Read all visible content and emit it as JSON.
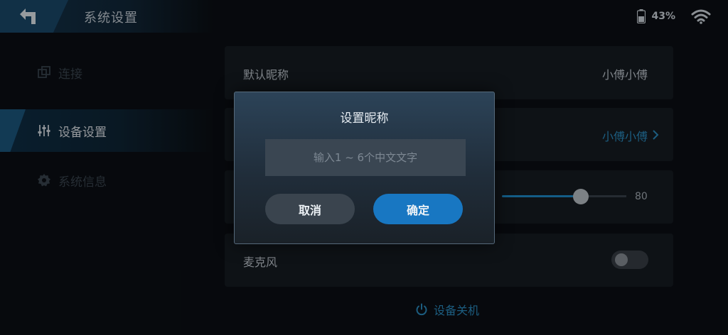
{
  "header": {
    "title": "系统设置",
    "battery": "43%"
  },
  "sidebar": {
    "items": [
      {
        "label": "连接",
        "icon": "link-icon"
      },
      {
        "label": "设备设置",
        "icon": "sliders-icon",
        "active": true
      },
      {
        "label": "系统信息",
        "icon": "gear-icon"
      }
    ]
  },
  "settings": {
    "nickname_label": "默认昵称",
    "nickname_value": "小傅小傅",
    "row2_value": "小傅小傅",
    "volume_value": "80",
    "volume_level": 0.8,
    "mic_label": "麦克风",
    "mic_on": false,
    "shutdown_label": "设备关机"
  },
  "dialog": {
    "title": "设置昵称",
    "input_placeholder": "输入1 ~ 6个中文文字",
    "input_value": "",
    "cancel_label": "取消",
    "ok_label": "确定"
  },
  "colors": {
    "accent": "#1877c2",
    "link": "#2c8fc5",
    "background": "#0b0f14"
  }
}
